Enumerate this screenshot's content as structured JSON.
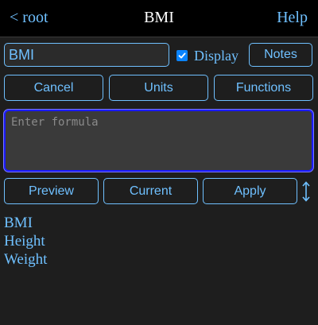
{
  "header": {
    "back_label": "< root",
    "title": "BMI",
    "help_label": "Help"
  },
  "name_field": {
    "value": "BMI"
  },
  "display_toggle": {
    "label": "Display",
    "checked": true
  },
  "buttons": {
    "notes": "Notes",
    "cancel": "Cancel",
    "units": "Units",
    "functions": "Functions",
    "preview": "Preview",
    "current": "Current",
    "apply": "Apply"
  },
  "formula": {
    "placeholder": "Enter formula",
    "value": ""
  },
  "variables": [
    "BMI",
    "Height",
    "Weight"
  ],
  "colors": {
    "accent": "#6fc0ff",
    "background": "#1e1e1e",
    "header": "#000000",
    "focus_border": "#1a1aff",
    "checkbox": "#0a84ff"
  },
  "icons": {
    "resize": "vertical-resize-icon",
    "check": "checkmark-icon"
  }
}
